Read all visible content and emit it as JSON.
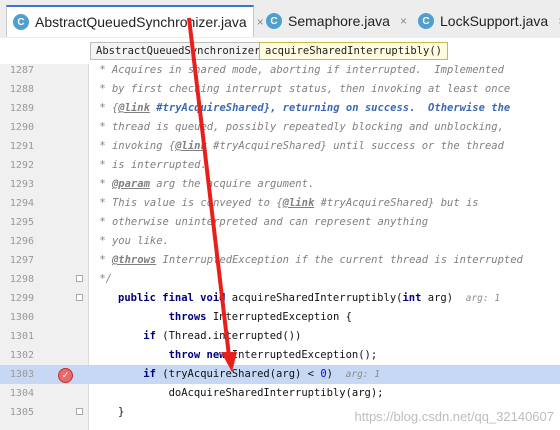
{
  "tabs": [
    {
      "label": "AbstractQueuedSynchronizer.java",
      "icon": "C",
      "active": true
    },
    {
      "label": "Semaphore.java",
      "icon": "C",
      "active": false
    },
    {
      "label": "LockSupport.java",
      "icon": "C",
      "active": false
    }
  ],
  "close_glyph": "×",
  "breadcrumb": {
    "class_name": "AbstractQueuedSynchronizer",
    "method": "acquireSharedInterruptibly()"
  },
  "lines": [
    {
      "n": "1287",
      "code": " * Acquires in shared mode, aborting if interrupted.  Implemented"
    },
    {
      "n": "1288",
      "code": " * by first checking interrupt status, then invoking at least once"
    },
    {
      "n": "1289",
      "pre": " * {",
      "link": "@link",
      "mid": " #tryAcquireShared}, returning on success.  Otherwise the"
    },
    {
      "n": "1290",
      "code": " * thread is queued, possibly repeatedly blocking and unblocking,"
    },
    {
      "n": "1291",
      "pre": " * invoking {",
      "link": "@link",
      "mid": " #tryAcquireShared} until success or the thread"
    },
    {
      "n": "1292",
      "code": " * is interrupted."
    },
    {
      "n": "1293",
      "pre": " * ",
      "link": "@param",
      "mid": " arg the acquire argument."
    },
    {
      "n": "1294",
      "pre": " * This value is conveyed to {",
      "link": "@link",
      "mid": " #tryAcquireShared} but is"
    },
    {
      "n": "1295",
      "code": " * otherwise uninterpreted and can represent anything"
    },
    {
      "n": "1296",
      "code": " * you like."
    },
    {
      "n": "1297",
      "pre": " * ",
      "link": "@throws",
      "mid": " InterruptedException if the current thread is interrupted"
    },
    {
      "n": "1298",
      "code": " */"
    },
    {
      "n": "1299",
      "kw": "public final void",
      "rest": " acquireSharedInterruptibly(",
      "kw2": "int",
      "rest2": " arg)",
      "hint": "arg: 1"
    },
    {
      "n": "1300",
      "kw": "        throws",
      "rest": " InterruptedException {"
    },
    {
      "n": "1301",
      "kw": "    if",
      "rest": " (Thread.interrupted())"
    },
    {
      "n": "1302",
      "kw": "        throw new",
      "rest": " InterruptedException();"
    },
    {
      "n": "1303",
      "kw": "    if",
      "rest": " (tryAcquireShared(arg) < ",
      "num": "0",
      "rest2": ")",
      "hint": "arg: 1",
      "breakpoint": true
    },
    {
      "n": "1304",
      "rest": "        doAcquireSharedInterruptibly(arg);"
    },
    {
      "n": "1305",
      "rest": "}"
    }
  ],
  "watermark": "https://blog.csdn.net/qq_32140607",
  "colors": {
    "tab_accent": "#3875d7",
    "highlight": "#c7d8f5",
    "breakpoint": "#e86a6a",
    "arrow": "#e8201c"
  },
  "icons": {
    "file_icon": "class-file-icon",
    "close_icon": "close-icon",
    "breakpoint_icon": "breakpoint-icon"
  }
}
